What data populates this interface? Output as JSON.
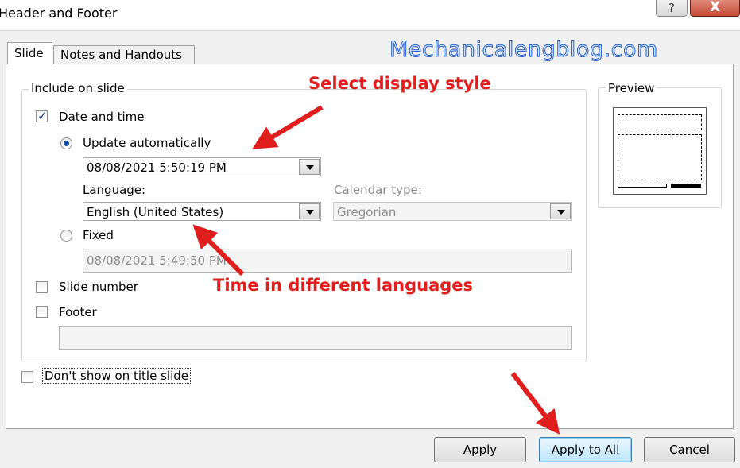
{
  "window": {
    "title": "Header and Footer",
    "help_label": "?",
    "close_label": "X"
  },
  "tabs": [
    {
      "label": "Slide",
      "active": true
    },
    {
      "label": "Notes and Handouts",
      "active": false
    }
  ],
  "watermark": "Mechanicalengblog.com",
  "include_group": {
    "title": "Include on slide",
    "date_time": {
      "label": "Date and time",
      "checked": true
    },
    "update_auto": {
      "label": "Update automatically",
      "selected": true
    },
    "datetime_value": "08/08/2021 5:50:19 PM",
    "language_label": "Language:",
    "language_value": "English (United States)",
    "calendar_label": "Calendar type:",
    "calendar_value": "Gregorian",
    "fixed": {
      "label": "Fixed",
      "selected": false
    },
    "fixed_value": "08/08/2021 5:49:50 PM",
    "slide_number": {
      "label": "Slide number",
      "checked": false
    },
    "footer": {
      "label": "Footer",
      "checked": false
    },
    "footer_value": ""
  },
  "dont_show": {
    "label": "Don't show on title slide",
    "checked": false
  },
  "preview": {
    "title": "Preview"
  },
  "buttons": {
    "apply": "Apply",
    "apply_all": "Apply to All",
    "cancel": "Cancel"
  },
  "annotations": {
    "select_style": "Select display style",
    "time_languages": "Time in different languages"
  },
  "colors": {
    "annotation": "#e01e1e",
    "accent": "#1d4d9e"
  }
}
